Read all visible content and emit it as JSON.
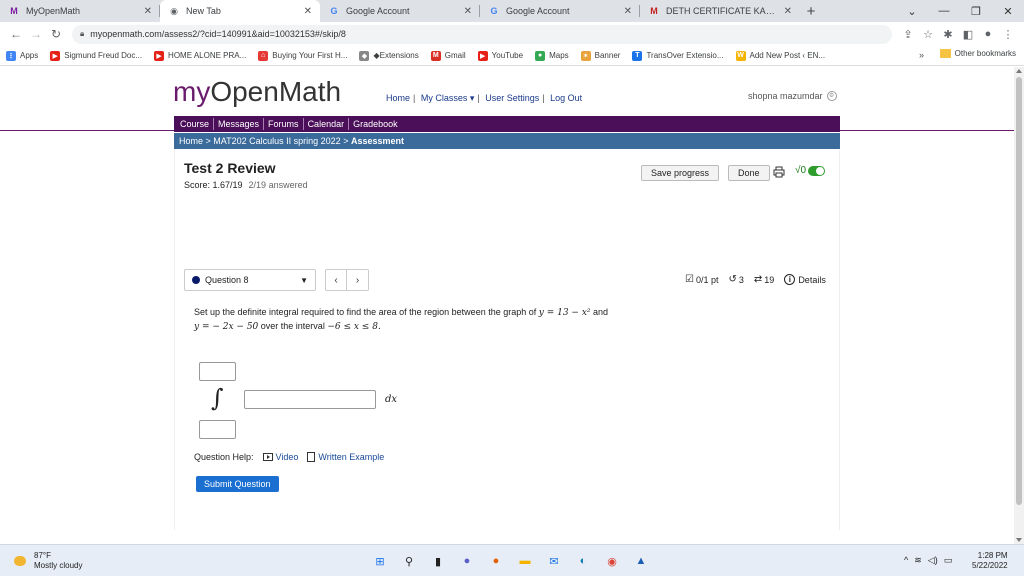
{
  "browser": {
    "tabs": [
      {
        "title": "MyOpenMath",
        "favicon": "M",
        "favicon_color": "#7b1fa2",
        "active": false
      },
      {
        "title": "New Tab",
        "favicon": "◉",
        "favicon_color": "#5f6368",
        "active": true
      },
      {
        "title": "Google Account",
        "favicon": "G",
        "favicon_color": "#4285f4",
        "active": false
      },
      {
        "title": "Google Account",
        "favicon": "G",
        "favicon_color": "#4285f4",
        "active": false
      },
      {
        "title": "DETH CERTIFICATE KALIPADA M...",
        "favicon": "M",
        "favicon_color": "#c5221f",
        "active": false
      }
    ],
    "url": "myopenmath.com/assess2/?cid=140991&aid=10032153#/skip/8",
    "bookmarks": [
      {
        "label": "Apps",
        "icon": "apps-grid-icon",
        "color": "#4285f4"
      },
      {
        "label": "Sigmund Freud Doc...",
        "icon": "youtube-icon",
        "color": "#e62117"
      },
      {
        "label": "HOME ALONE PRA...",
        "icon": "youtube-icon",
        "color": "#e62117"
      },
      {
        "label": "Buying Your First H...",
        "icon": "house-icon",
        "color": "#e53935"
      },
      {
        "label": "◆Extensions",
        "icon": "extension-icon",
        "color": "#888888"
      },
      {
        "label": "Gmail",
        "icon": "gmail-icon",
        "color": "#d93025"
      },
      {
        "label": "YouTube",
        "icon": "youtube-icon",
        "color": "#e62117"
      },
      {
        "label": "Maps",
        "icon": "maps-icon",
        "color": "#34a853"
      },
      {
        "label": "Banner",
        "icon": "banner-icon",
        "color": "#e8a33d"
      },
      {
        "label": "TransOver Extensio...",
        "icon": "transover-icon",
        "color": "#1a73e8"
      },
      {
        "label": "Add New Post ‹ EN...",
        "icon": "wordpress-icon",
        "color": "#f4b400"
      }
    ],
    "bookmarks_other": "Other bookmarks"
  },
  "site": {
    "logo_my": "my",
    "logo_rest": "OpenMath",
    "nav": {
      "home": "Home",
      "classes": "My Classes ▾",
      "settings": "User Settings",
      "logout": "Log Out"
    },
    "user": "shopna mazumdar",
    "course_nav": [
      "Course",
      "Messages",
      "Forums",
      "Calendar",
      "Gradebook"
    ],
    "breadcrumb": {
      "home": "Home",
      "course": "MAT202 Calculus II spring 2022",
      "current": "Assessment"
    },
    "accent": "#4b0f5a",
    "breadcrumb_color": "#3a6b9b"
  },
  "assessment": {
    "title": "Test 2 Review",
    "score_label": "Score: 1.67/19",
    "answered": "2/19 answered",
    "save_label": "Save progress",
    "done_label": "Done",
    "sqrt_label": "√0",
    "question_select": "Question 8",
    "prev": "‹",
    "next": "›",
    "points": "0/1 pt",
    "retries": "3",
    "attempts": "19",
    "details": "Details",
    "question_text_1": "Set up the definite integral required to find the area of the region between the graph of",
    "eq1": "y = 13 − x²",
    "and": "and",
    "eq2": "y = − 2x − 50",
    "question_text_2": "over the interval",
    "interval": "−6 ≤ x ≤ 8.",
    "integral_sign": "∫",
    "dx": "dx",
    "help_label": "Question Help:",
    "video_label": "Video",
    "example_label": "Written Example",
    "submit_label": "Submit Question"
  },
  "taskbar": {
    "temp": "87°F",
    "weather": "Mostly cloudy",
    "time": "1:28 PM",
    "date": "5/22/2022"
  }
}
